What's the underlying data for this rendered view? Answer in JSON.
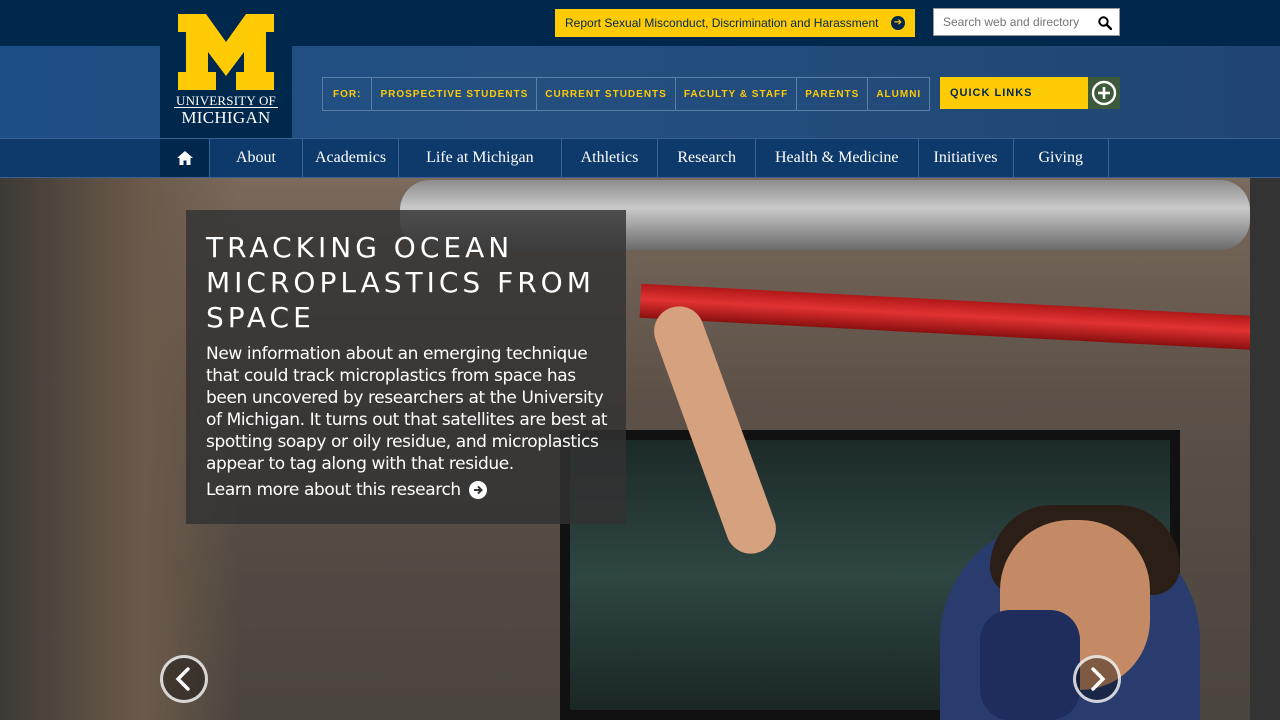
{
  "header": {
    "logo_top": "UNIVERSITY OF",
    "logo_bottom": "MICHIGAN",
    "report_label": "Report Sexual Misconduct, Discrimination and Harassment",
    "search_placeholder": "Search web and directory",
    "for_label": "FOR:",
    "audiences": [
      "PROSPECTIVE STUDENTS",
      "CURRENT STUDENTS",
      "FACULTY & STAFF",
      "PARENTS",
      "ALUMNI"
    ],
    "quick_links": "QUICK LINKS"
  },
  "nav": {
    "items": [
      "About",
      "Academics",
      "Life at Michigan",
      "Athletics",
      "Research",
      "Health & Medicine",
      "Initiatives",
      "Giving"
    ]
  },
  "hero": {
    "title": "TRACKING OCEAN MICROPLASTICS FROM SPACE",
    "body": "New information about an emerging technique that could track microplastics from space has been uncovered by researchers at the University of Michigan. It turns out that satellites are best at spotting soapy or oily residue, and microplastics appear to tag along with that residue.",
    "link": "Learn more about this research"
  },
  "colors": {
    "maize": "#ffcb05",
    "blue": "#00274c"
  }
}
